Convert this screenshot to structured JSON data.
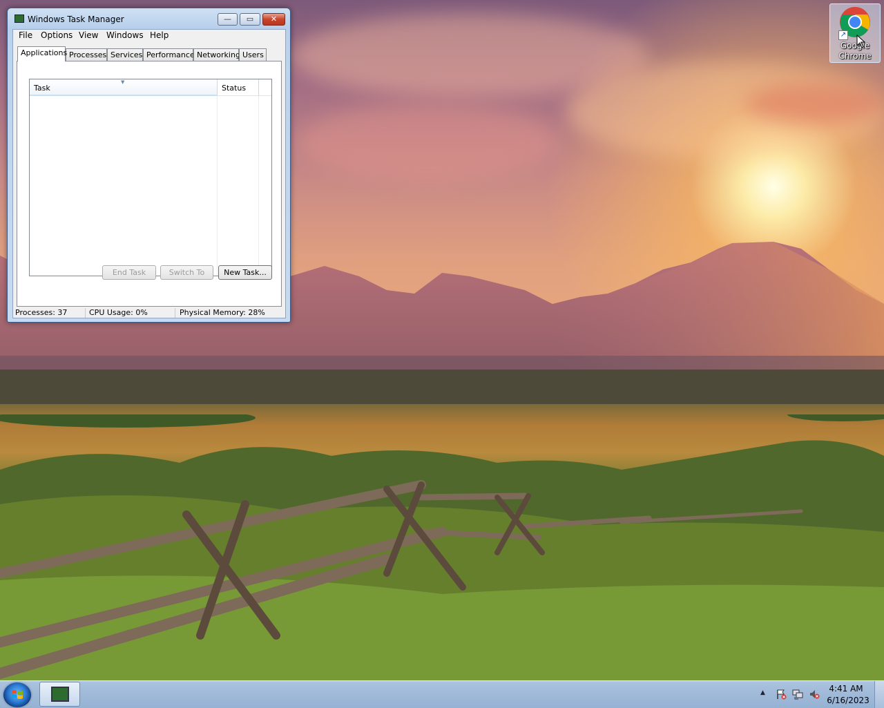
{
  "desktop": {
    "icons": [
      {
        "label": "Google Chrome",
        "icon": "chrome-icon"
      }
    ]
  },
  "task_manager": {
    "title": "Windows Task Manager",
    "caption_buttons": {
      "minimize": "—",
      "maximize": "▭",
      "close": "✕"
    },
    "menu": [
      "File",
      "Options",
      "View",
      "Windows",
      "Help"
    ],
    "tabs": [
      "Applications",
      "Processes",
      "Services",
      "Performance",
      "Networking",
      "Users"
    ],
    "active_tab": "Applications",
    "columns": [
      "Task",
      "Status"
    ],
    "rows": [],
    "buttons": {
      "end_task": "End Task",
      "switch_to": "Switch To",
      "new_task": "New Task..."
    },
    "status": {
      "processes": "Processes: 37",
      "cpu": "CPU Usage: 0%",
      "memory": "Physical Memory: 28%"
    }
  },
  "taskbar": {
    "start_icon": "windows-logo-icon",
    "pinned": [
      {
        "icon": "task-manager-icon"
      }
    ],
    "tray": {
      "show_hidden": "▲",
      "icons": [
        "action-center-icon",
        "network-icon",
        "volume-muted-icon"
      ],
      "time": "4:41 AM",
      "date": "6/16/2023"
    }
  },
  "colors": {
    "title_bar": "#bcd3ee",
    "close_button": "#c8452c",
    "taskbar": "#a9c2df"
  }
}
